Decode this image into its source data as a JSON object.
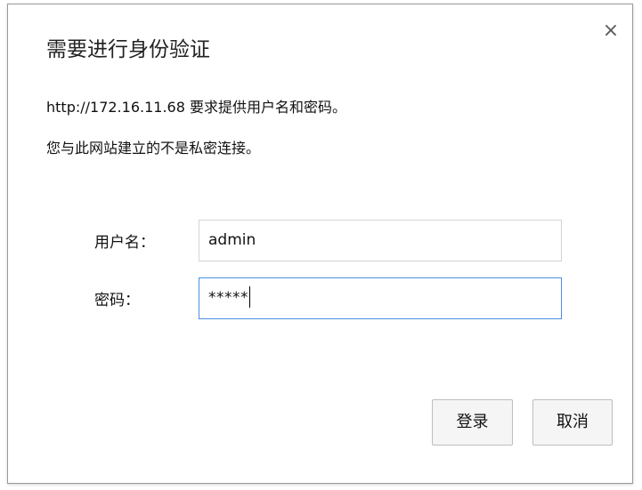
{
  "dialog": {
    "title": "需要进行身份验证",
    "close_icon": "×",
    "message_line1": "http://172.16.11.68 要求提供用户名和密码。",
    "message_line2": "您与此网站建立的不是私密连接。",
    "username_label": "用户名：",
    "username_value": "admin",
    "password_label": "密码：",
    "password_value": "*****",
    "login_button": "登录",
    "cancel_button": "取消"
  },
  "colors": {
    "focus_border": "#4a90e2",
    "input_border": "#d4d4d4",
    "button_bg": "#f5f5f5"
  }
}
